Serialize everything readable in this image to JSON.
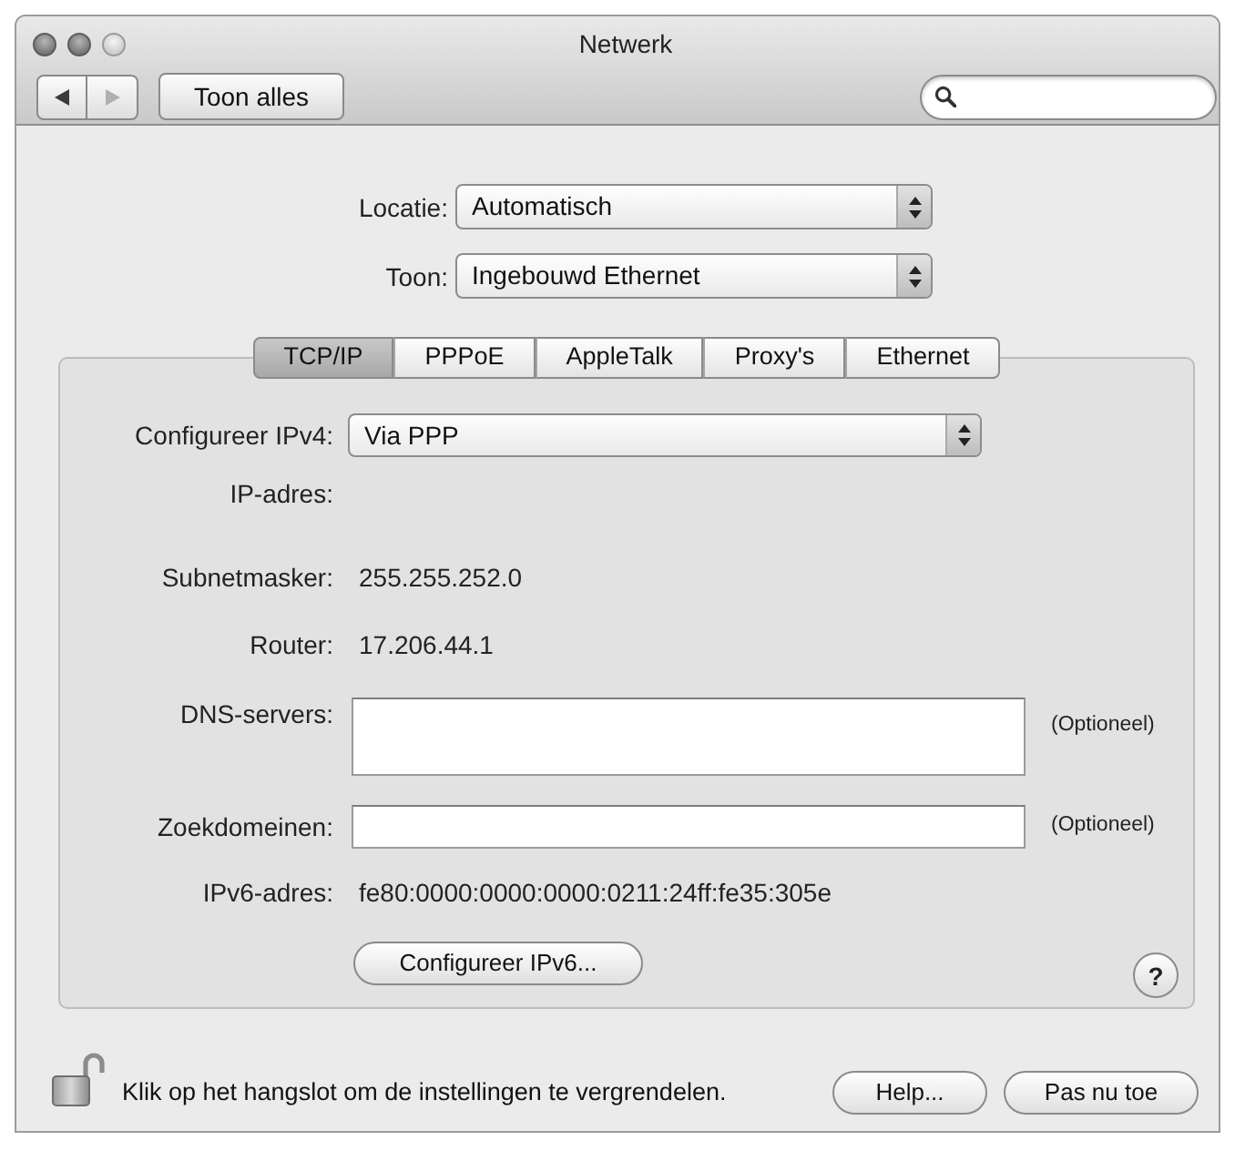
{
  "window": {
    "title": "Netwerk"
  },
  "toolbar": {
    "nav": [
      {
        "kind": "back",
        "disabled": false
      },
      {
        "kind": "forward",
        "disabled": true
      }
    ],
    "show_all": "Toon alles"
  },
  "location": {
    "label": "Locatie:",
    "value": "Automatisch"
  },
  "show": {
    "label": "Toon:",
    "value": "Ingebouwd Ethernet"
  },
  "tabs": [
    {
      "label": "TCP/IP",
      "selected": true
    },
    {
      "label": "PPPoE",
      "selected": false
    },
    {
      "label": "AppleTalk",
      "selected": false
    },
    {
      "label": "Proxy's",
      "selected": false
    },
    {
      "label": "Ethernet",
      "selected": false
    }
  ],
  "tcpip": {
    "rows": [
      {
        "kind": "popup",
        "label": "Configureer IPv4:",
        "value": "Via PPP"
      },
      {
        "kind": "text",
        "label": "IP-adres:"
      },
      {
        "kind": "text",
        "label": "Subnetmasker:",
        "value": "255.255.252.0"
      },
      {
        "kind": "text",
        "label": "Router:",
        "value": "17.206.44.1"
      },
      {
        "kind": "area",
        "label": "DNS-servers:",
        "note": "(Optioneel)"
      },
      {
        "kind": "input",
        "label": "Zoekdomeinen:",
        "note": "(Optioneel)"
      },
      {
        "kind": "text",
        "label": "IPv6-adres:",
        "value": "fe80:0000:0000:0000:0211:24ff:fe35:305e"
      }
    ],
    "ipv6_button": "Configureer IPv6...",
    "help": "?"
  },
  "footer": {
    "lock": {
      "locked": false
    },
    "message": "Klik op het hangslot om de instellingen te vergrendelen.",
    "buttons": [
      "Help...",
      "Pas nu toe"
    ]
  }
}
